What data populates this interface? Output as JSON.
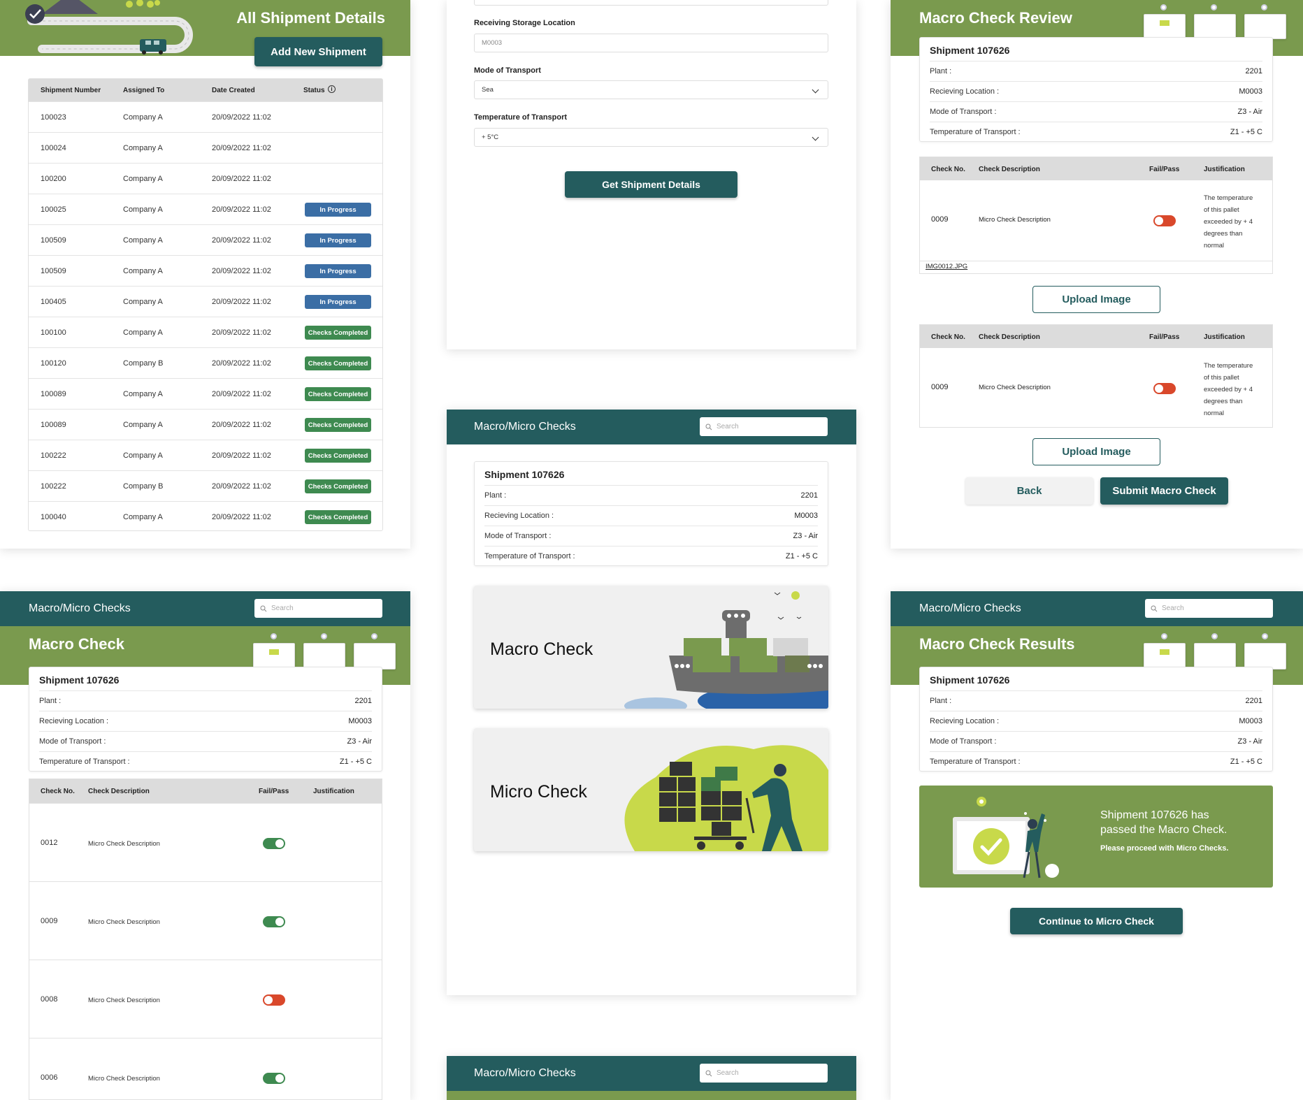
{
  "colors": {
    "teal": "#245c5e",
    "green": "#7a9a4e",
    "inprogress": "#3b6ea5",
    "completed": "#3e8a50",
    "fail": "#d9482b"
  },
  "panel_all": {
    "title": "All Shipment Details",
    "add_button": "Add New Shipment",
    "columns": [
      "Shipment Number",
      "Assigned To",
      "Date Created",
      "Status"
    ],
    "rows": [
      {
        "num": "100023",
        "to": "Company A",
        "date": "20/09/2022  11:02",
        "status": ""
      },
      {
        "num": "100024",
        "to": "Company A",
        "date": "20/09/2022  11:02",
        "status": ""
      },
      {
        "num": "100200",
        "to": "Company A",
        "date": "20/09/2022  11:02",
        "status": ""
      },
      {
        "num": "100025",
        "to": "Company A",
        "date": "20/09/2022  11:02",
        "status": "In Progress"
      },
      {
        "num": "100509",
        "to": "Company A",
        "date": "20/09/2022  11:02",
        "status": "In Progress"
      },
      {
        "num": "100509",
        "to": "Company A",
        "date": "20/09/2022  11:02",
        "status": "In Progress"
      },
      {
        "num": "100405",
        "to": "Company A",
        "date": "20/09/2022  11:02",
        "status": "In Progress"
      },
      {
        "num": "100100",
        "to": "Company A",
        "date": "20/09/2022  11:02",
        "status": "Checks Completed"
      },
      {
        "num": "100120",
        "to": "Company B",
        "date": "20/09/2022  11:02",
        "status": "Checks Completed"
      },
      {
        "num": "100089",
        "to": "Company A",
        "date": "20/09/2022  11:02",
        "status": "Checks Completed"
      },
      {
        "num": "100089",
        "to": "Company A",
        "date": "20/09/2022  11:02",
        "status": "Checks Completed"
      },
      {
        "num": "100222",
        "to": "Company A",
        "date": "20/09/2022  11:02",
        "status": "Checks Completed"
      },
      {
        "num": "100222",
        "to": "Company B",
        "date": "20/09/2022  11:02",
        "status": "Checks Completed"
      },
      {
        "num": "100040",
        "to": "Company A",
        "date": "20/09/2022  11:02",
        "status": "Checks Completed"
      }
    ]
  },
  "panel_form": {
    "storage_label": "Receiving Storage Location",
    "storage_value": "M0003",
    "mode_label": "Mode of Transport",
    "mode_value": "Sea",
    "temp_label": "Temperature of Transport",
    "temp_value": "+ 5°C",
    "button": "Get Shipment Details"
  },
  "shipment": {
    "title": "Shipment 107626",
    "fields": [
      {
        "label": "Plant :",
        "value": "2201"
      },
      {
        "label": "Recieving Location :",
        "value": "M0003"
      },
      {
        "label": "Mode of Transport :",
        "value": "Z3 - Air"
      },
      {
        "label": "Temperature of Transport :",
        "value": "Z1 - +5 C"
      }
    ]
  },
  "app_header": {
    "title": "Macro/Micro Checks",
    "search_placeholder": "Search"
  },
  "panel_review": {
    "title": "Macro Check Review",
    "columns": [
      "Check No.",
      "Check Description",
      "Fail/Pass",
      "Justification"
    ],
    "checks": [
      {
        "no": "0009",
        "desc": "Micro Check Description",
        "pass": false,
        "justification": "The temperature of this pallet exceeded by + 4 degrees than normal",
        "file": "IMG0012.JPG"
      },
      {
        "no": "0009",
        "desc": "Micro Check Description",
        "pass": false,
        "justification": "The temperature of this pallet exceeded by + 4 degrees than normal",
        "file": ""
      }
    ],
    "upload": "Upload Image",
    "back": "Back",
    "submit": "Submit Macro Check"
  },
  "panel_select": {
    "macro": "Macro Check",
    "micro": "Micro Check"
  },
  "panel_macro": {
    "title": "Macro Check",
    "columns": [
      "Check No.",
      "Check Description",
      "Fail/Pass",
      "Justification"
    ],
    "checks": [
      {
        "no": "0012",
        "desc": "Micro Check Description",
        "pass": true
      },
      {
        "no": "0009",
        "desc": "Micro Check Description",
        "pass": true
      },
      {
        "no": "0008",
        "desc": "Micro Check Description",
        "pass": false
      },
      {
        "no": "0006",
        "desc": "Micro Check Description",
        "pass": true
      }
    ]
  },
  "panel_results": {
    "title": "Macro Check Results",
    "msg1": "Shipment 107626  has",
    "msg2": "passed the Macro Check.",
    "msg3": "Please proceed with Micro Checks.",
    "button": "Continue to Micro Check"
  }
}
